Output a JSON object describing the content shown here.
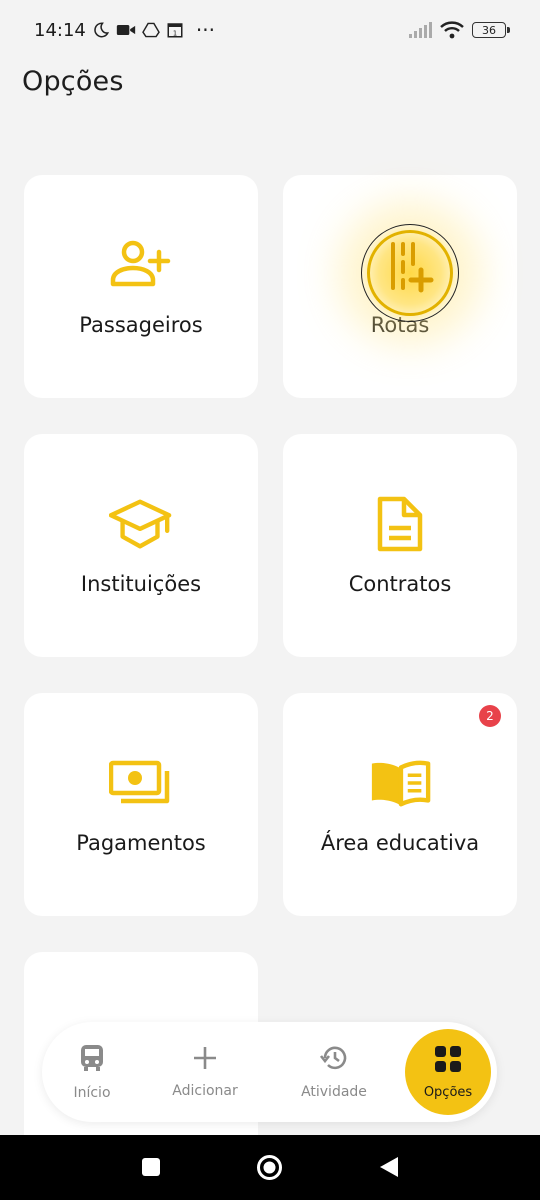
{
  "status_bar": {
    "time": "14:14",
    "battery": "36",
    "more": "···"
  },
  "page": {
    "title": "Opções"
  },
  "cards": [
    {
      "label": "Passageiros",
      "icon": "add-person-icon"
    },
    {
      "label": "Rotas",
      "icon": "route-add-icon"
    },
    {
      "label": "Instituições",
      "icon": "graduation-cap-icon"
    },
    {
      "label": "Contratos",
      "icon": "document-icon"
    },
    {
      "label": "Pagamentos",
      "icon": "payments-icon"
    },
    {
      "label": "Área educativa",
      "icon": "open-book-icon",
      "badge": "2"
    },
    {
      "label": "",
      "icon": "document-partial-icon"
    }
  ],
  "bottom_nav": [
    {
      "label": "Início",
      "icon": "bus-icon"
    },
    {
      "label": "Adicionar",
      "icon": "plus-icon"
    },
    {
      "label": "Atividade",
      "icon": "history-icon"
    },
    {
      "label": "Opções",
      "icon": "grid-icon",
      "active": true
    }
  ],
  "colors": {
    "accent": "#f3c213",
    "badge": "#e8424a",
    "background": "#f3f3f3"
  }
}
